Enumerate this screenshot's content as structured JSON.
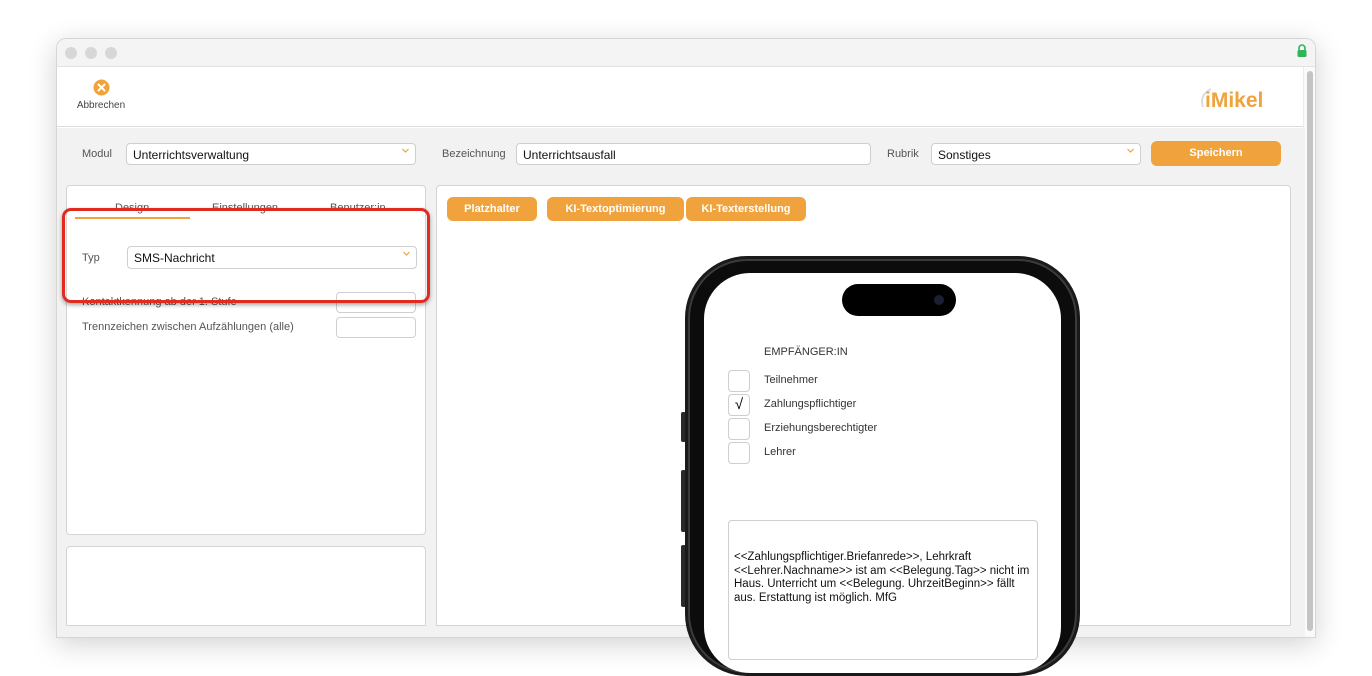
{
  "toolbar": {
    "cancel_label": "Abbrechen",
    "logo_text": "iMikel"
  },
  "header": {
    "modul_label": "Modul",
    "modul_value": "Unterrichtsverwaltung",
    "bezeichnung_label": "Bezeichnung",
    "bezeichnung_value": "Unterrichtsausfall",
    "rubrik_label": "Rubrik",
    "rubrik_value": "Sonstiges",
    "save_label": "Speichern"
  },
  "left_panel": {
    "tabs": [
      {
        "label": "Design"
      },
      {
        "label": "Einstellungen"
      },
      {
        "label": "Benutzer:in"
      }
    ],
    "typ_label": "Typ",
    "typ_value": "SMS-Nachricht",
    "kontakt_label": "Kontaktkennung ab der 1. Stufe",
    "trenn_label": "Trennzeichen zwischen Aufzählungen (alle)"
  },
  "right_panel": {
    "buttons": {
      "platzhalter": "Platzhalter",
      "ki_opt": "KI-Textoptimierung",
      "ki_erst": "KI-Texterstellung"
    },
    "recipients_title": "EMPFÄNGER:IN",
    "recipients": [
      {
        "label": "Teilnehmer",
        "checked": false,
        "mark": ""
      },
      {
        "label": "Zahlungspflichtiger",
        "checked": true,
        "mark": "√"
      },
      {
        "label": "Erziehungsberechtigter",
        "checked": false,
        "mark": ""
      },
      {
        "label": "Lehrer",
        "checked": false,
        "mark": ""
      }
    ],
    "message": "<<Zahlungspflichtiger.Briefanrede>>, Lehrkraft <<Lehrer.Nachname>> ist am <<Belegung.Tag>> nicht im Haus. Unterricht um <<Belegung. UhrzeitBeginn>> fällt aus. Erstattung ist möglich. MfG"
  },
  "colors": {
    "accent": "#f0a23c",
    "highlight": "#e02b20",
    "secure": "#2fb457"
  }
}
